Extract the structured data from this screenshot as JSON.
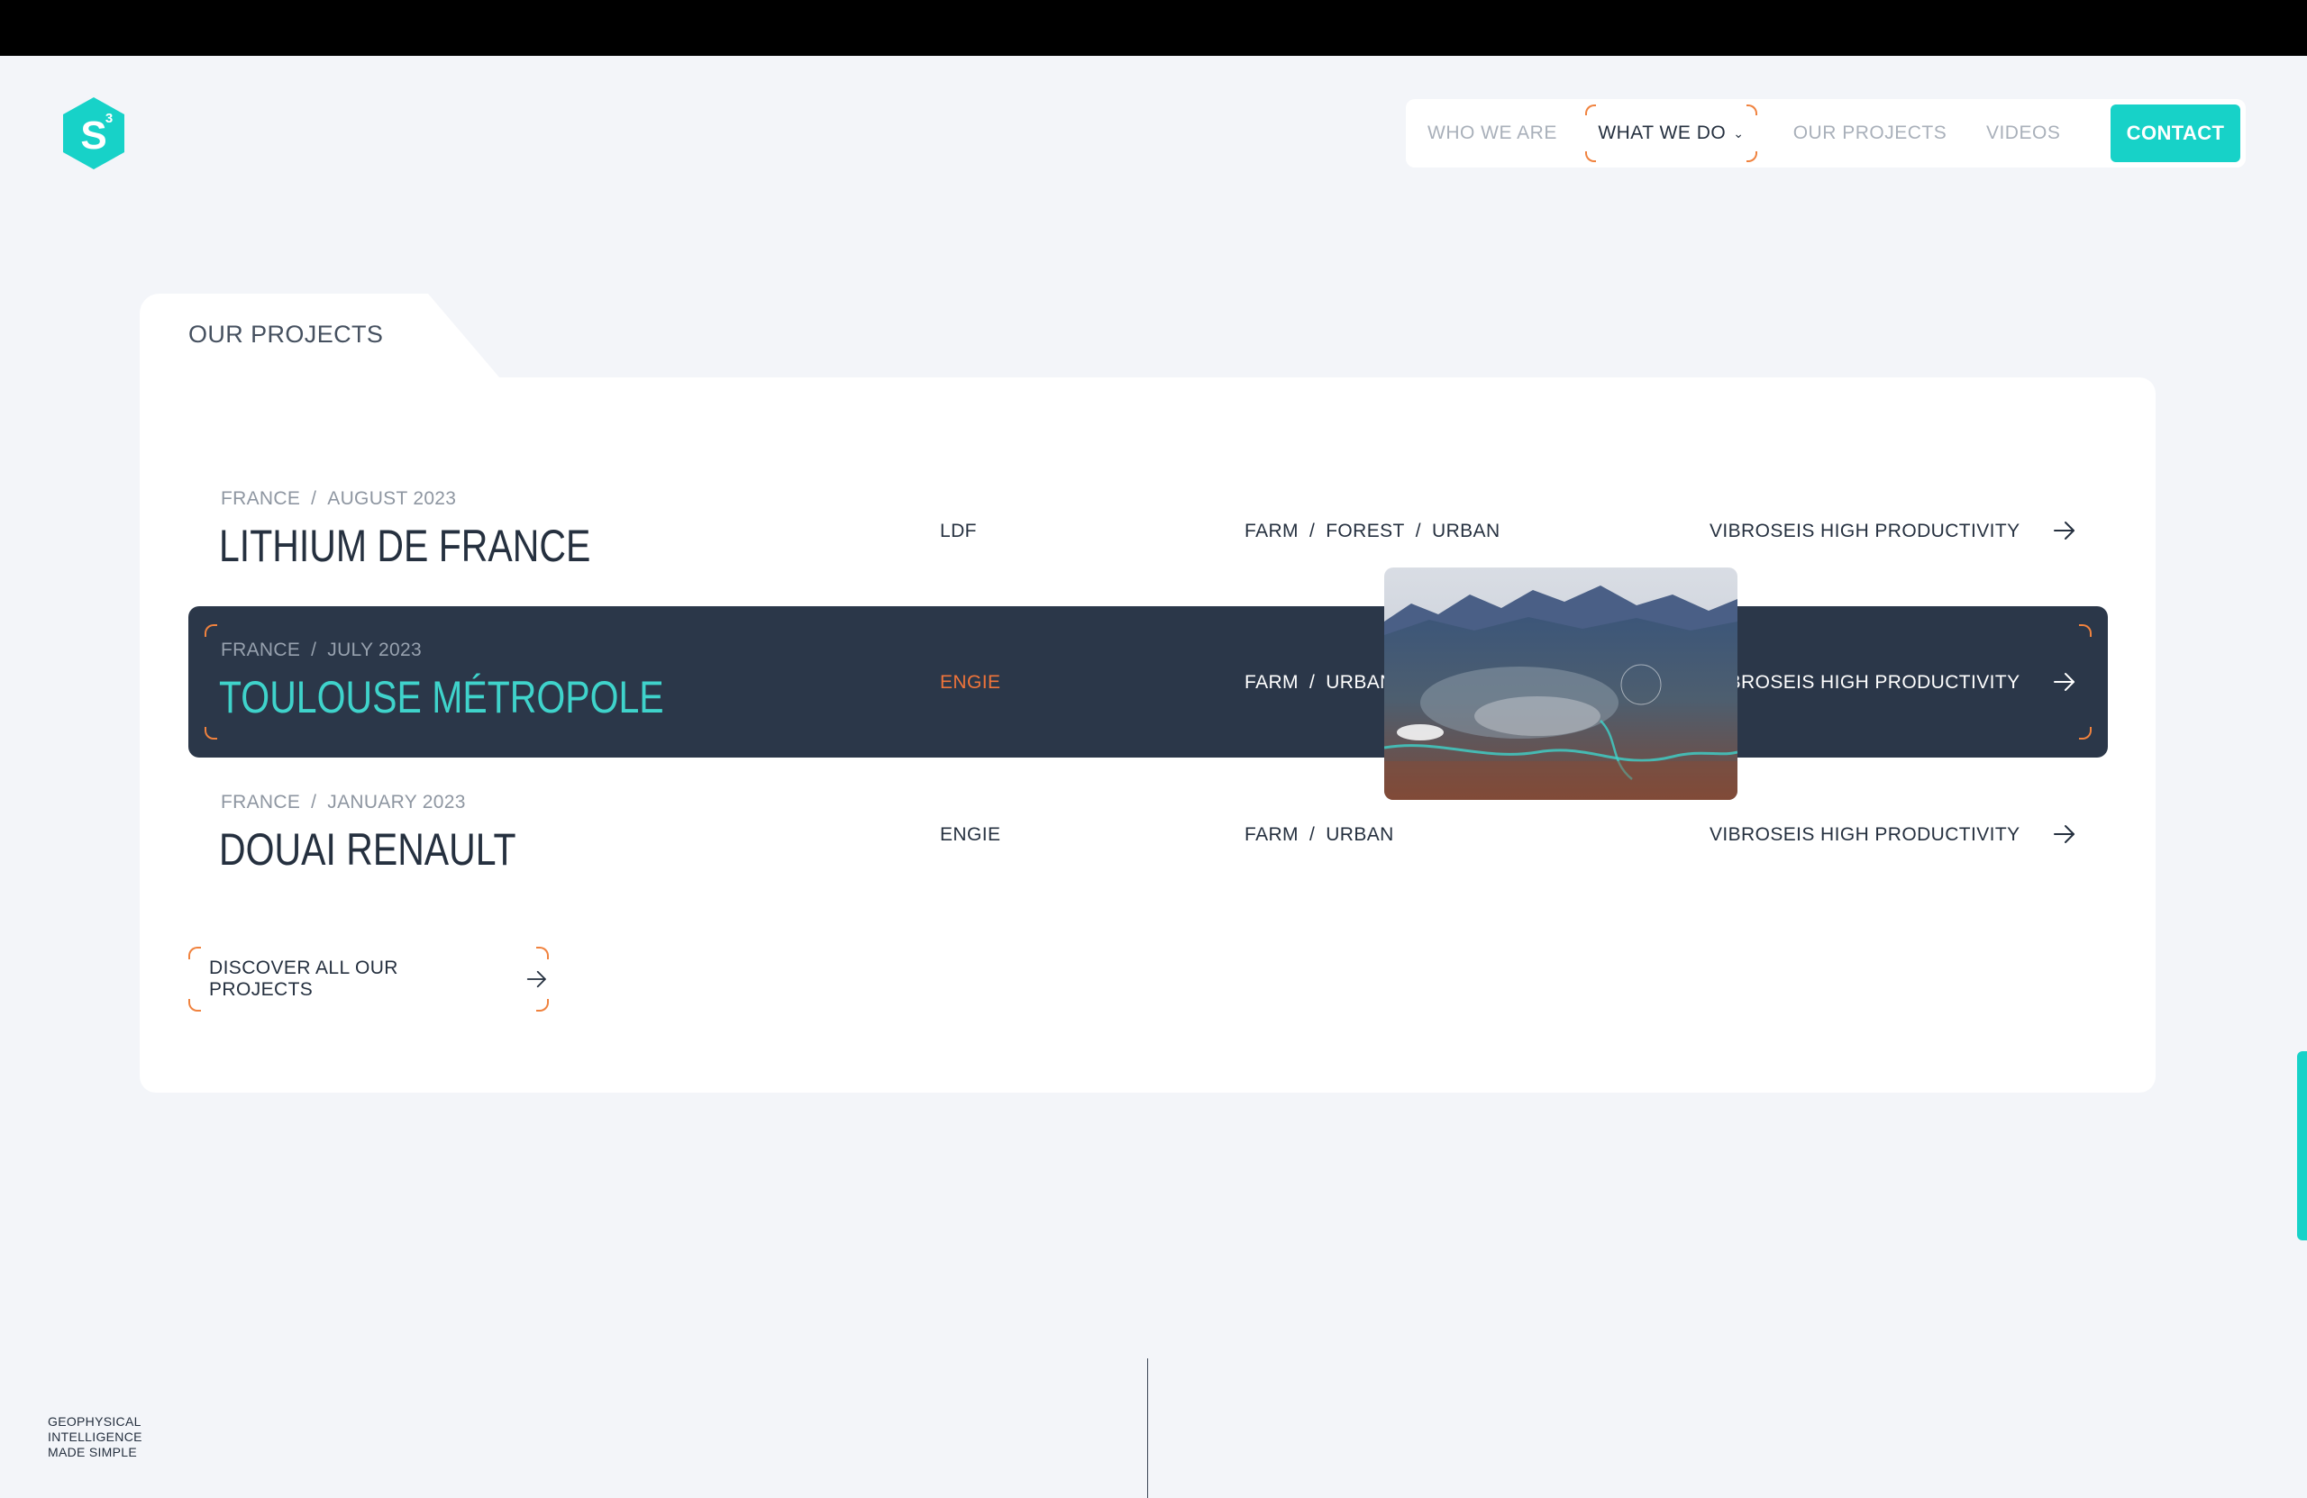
{
  "nav": {
    "who_we_are": "WHO WE ARE",
    "what_we_do": "WHAT WE DO",
    "our_projects": "OUR PROJECTS",
    "videos": "VIDEOS",
    "contact": "CONTACT"
  },
  "section": {
    "tab_label": "OUR PROJECTS"
  },
  "projects": [
    {
      "country": "FRANCE",
      "date": "AUGUST 2023",
      "title": "LITHIUM DE FRANCE",
      "client": "LDF",
      "tags": [
        "FARM",
        "FOREST",
        "URBAN"
      ],
      "method": "VIBROSEIS HIGH PRODUCTIVITY"
    },
    {
      "country": "FRANCE",
      "date": "JULY 2023",
      "title": "TOULOUSE MÉTROPOLE",
      "client": "ENGIE",
      "tags": [
        "FARM",
        "URBAN"
      ],
      "method": "VIBROSEIS HIGH PRODUCTIVITY"
    },
    {
      "country": "FRANCE",
      "date": "JANUARY 2023",
      "title": "DOUAI RENAULT",
      "client": "ENGIE",
      "tags": [
        "FARM",
        "URBAN"
      ],
      "method": "VIBROSEIS HIGH PRODUCTIVITY"
    }
  ],
  "discover": {
    "label": "DISCOVER ALL OUR PROJECTS"
  },
  "tagline": {
    "line1": "GEOPHYSICAL",
    "line2": "INTELLIGENCE",
    "line3": "MADE SIMPLE"
  },
  "colors": {
    "accent": "#17d2c8",
    "highlight": "#f0823e",
    "dark_row": "#2b3749",
    "background": "#f3f5f9"
  }
}
